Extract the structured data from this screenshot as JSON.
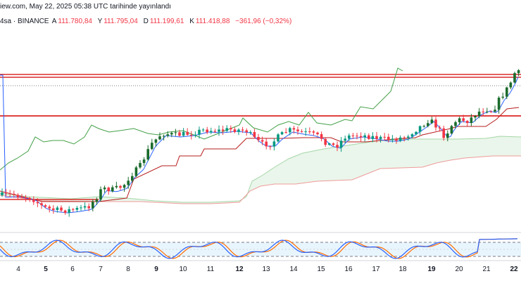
{
  "header": {
    "source_line": "iew.com, May 22, 2025 05:38 UTC tarihinde yayınlandı",
    "symbol_line": "4sa · BINANCE",
    "ohlc": [
      {
        "label": "A",
        "value": "111.780,84"
      },
      {
        "label": "Y",
        "value": "111.795,04"
      },
      {
        "label": "D",
        "value": "111.199,61"
      },
      {
        "label": "K",
        "value": "111.418,88"
      }
    ],
    "change": "−361,96 (−0,32%)"
  },
  "x_axis": {
    "ticks": [
      "4",
      "5",
      "6",
      "7",
      "8",
      "9",
      "10",
      "11",
      "12",
      "13",
      "14",
      "15",
      "16",
      "17",
      "18",
      "19",
      "20",
      "21",
      "22"
    ],
    "bold_ticks": [
      "5",
      "9",
      "12",
      "19",
      "22"
    ]
  },
  "colors": {
    "up": "#089981",
    "up_dark": "#1b6b2c",
    "down": "#f23645",
    "tenkan": "#2962ff",
    "kijun": "#b71c1c",
    "chikou": "#43a047",
    "cloud_green": "#a5d6a7",
    "cloud_red": "#ef9a9a",
    "resistance": "#d50000",
    "stoch_k": "#2962ff",
    "stoch_d": "#ff6d00"
  },
  "chart_data": {
    "type": "candlestick",
    "x": [
      "4",
      "5",
      "6",
      "7",
      "8",
      "9",
      "10",
      "11",
      "12",
      "13",
      "14",
      "15",
      "16",
      "17",
      "18",
      "19",
      "20",
      "21",
      "22"
    ],
    "indicators": [
      "Ichimoku Cloud",
      "Stochastic RSI"
    ],
    "grid": false
  }
}
